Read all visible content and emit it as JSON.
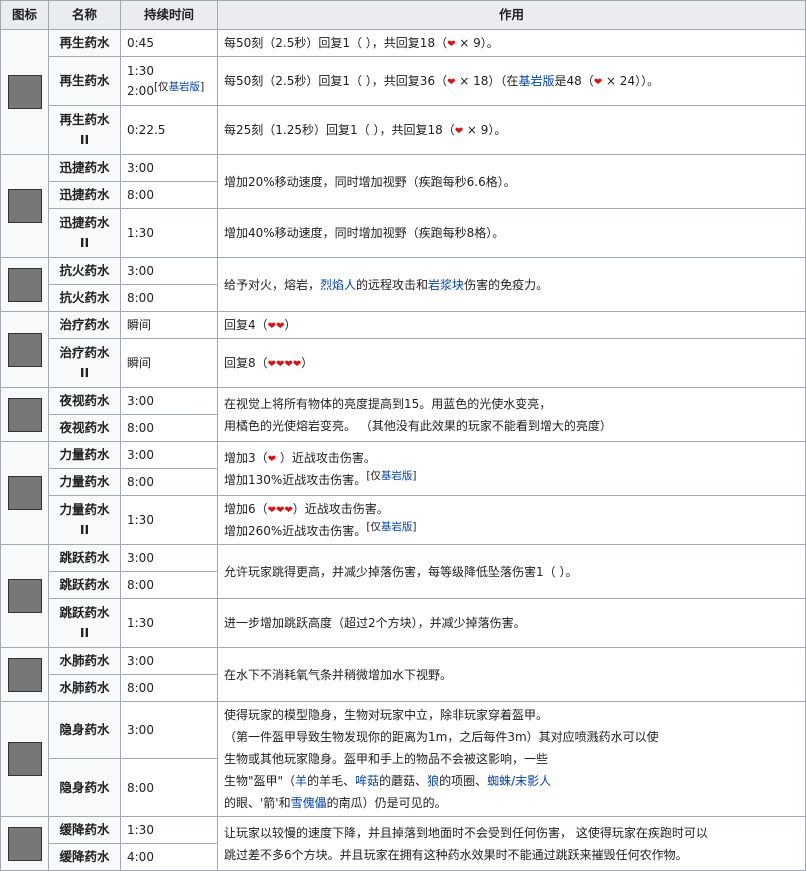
{
  "headers": [
    "图标",
    "名称",
    "持续时间",
    "作用"
  ],
  "heart_glyph": "❤",
  "heart_color": "#dd1111",
  "link_color": "#0645ad",
  "regen": {
    "name1": "再生药水",
    "dur1": "0:45",
    "eff1_a": "每50刻（2.5秒）回复1（ ），共回复18（",
    "eff1_b": " × 9）。",
    "name2": "再生药水",
    "dur2_a": "1:30",
    "dur2_b": "2:00",
    "dur2_tag_pre": "[仅",
    "dur2_tag_link": "基岩版",
    "dur2_tag_post": "]",
    "eff2_a": "每50刻（2.5秒）回复1（ ），共回复36（",
    "eff2_b": " × 18）（在",
    "eff2_link": "基岩版",
    "eff2_c": "是48（",
    "eff2_d": " × 24））。",
    "name3": "再生药水II",
    "dur3": "0:22.5",
    "eff3_a": "每25刻（1.25秒）回复1（ ），共回复18（",
    "eff3_b": " × 9）。"
  },
  "swift": {
    "name1": "迅捷药水",
    "dur1": "3:00",
    "name2": "迅捷药水",
    "dur2": "8:00",
    "eff12": "增加20%移动速度，同时增加视野（疾跑每秒6.6格）。",
    "name3": "迅捷药水II",
    "dur3": "1:30",
    "eff3": "增加40%移动速度，同时增加视野（疾跑每秒8格）。"
  },
  "fire": {
    "name1": "抗火药水",
    "dur1": "3:00",
    "name2": "抗火药水",
    "dur2": "8:00",
    "eff_a": "给予对火，熔岩，",
    "eff_link1": "烈焰人",
    "eff_b": "的远程攻击和",
    "eff_link2": "岩浆块",
    "eff_c": "伤害的免疫力。"
  },
  "heal": {
    "name1": "治疗药水",
    "dur1": "瞬间",
    "eff1": "回复4（",
    "hearts1": "❤❤",
    "eff1_end": "）",
    "name2": "治疗药水II",
    "dur2": "瞬间",
    "eff2": "回复8（",
    "hearts2": "❤❤❤❤",
    "eff2_end": "）"
  },
  "night": {
    "name1": "夜视药水",
    "dur1": "3:00",
    "name2": "夜视药水",
    "dur2": "8:00",
    "eff_line1": "在视觉上将所有物体的亮度提高到15。用蓝色的光使水变亮，",
    "eff_line2": "用橘色的光使熔岩变亮。 （其他没有此效果的玩家不能看到增大的亮度）"
  },
  "strength": {
    "name1": "力量药水",
    "dur1": "3:00",
    "name2": "力量药水",
    "dur2": "8:00",
    "eff12_a": "增加3（",
    "eff12_b": " ）近战攻击伤害。",
    "eff12_c": "增加130%近战攻击伤害。",
    "tag_pre": "[仅",
    "tag_link": "基岩版",
    "tag_post": "]",
    "name3": "力量药水II",
    "dur3": "1:30",
    "eff3_a": "增加6（",
    "hearts3": "❤❤❤",
    "eff3_b": "）近战攻击伤害。",
    "eff3_c": "增加260%近战攻击伤害。"
  },
  "leap": {
    "name1": "跳跃药水",
    "dur1": "3:00",
    "name2": "跳跃药水",
    "dur2": "8:00",
    "eff12": "允许玩家跳得更高，并减少掉落伤害，每等级降低坠落伤害1（ ）。",
    "name3": "跳跃药水II",
    "dur3": "1:30",
    "eff3": "进一步增加跳跃高度（超过2个方块），并减少掉落伤害。"
  },
  "water": {
    "name1": "水肺药水",
    "dur1": "3:00",
    "name2": "水肺药水",
    "dur2": "8:00",
    "eff": "在水下不消耗氧气条并稍微增加水下视野。"
  },
  "invis": {
    "name1": "隐身药水",
    "dur1": "3:00",
    "name2": "隐身药水",
    "dur2": "8:00",
    "l1": "使得玩家的模型隐身，生物对玩家中立，除非玩家穿着盔甲。",
    "l2": "（第一件盔甲导致生物发现你的距离为1m，之后每件3m）其对应喷溅药水可以使",
    "l3": "生物或其他玩家隐身。盔甲和手上的物品不会被这影响，一些",
    "l4_a": "生物\"盔甲\"（",
    "l4_link1": "羊",
    "l4_b": "的羊毛、",
    "l4_link2": "哞菇",
    "l4_c": "的蘑菇、",
    "l4_link3": "狼",
    "l4_d": "的项圈、",
    "l4_link4": "蜘蛛/末影人",
    "l5_a": "的眼、'箭'和",
    "l5_link": "雪傀儡",
    "l5_b": "的南瓜）仍是可见的。"
  },
  "slow": {
    "name1": "缓降药水",
    "dur1": "1:30",
    "name2": "缓降药水",
    "dur2": "4:00",
    "l1": "让玩家以较慢的速度下降，并且掉落到地面时不会受到任何伤害， 这使得玩家在疾跑时可以",
    "l2": "跳过差不多6个方块。并且玩家在拥有这种药水效果时不能通过跳跃来摧毁任何农作物。"
  }
}
